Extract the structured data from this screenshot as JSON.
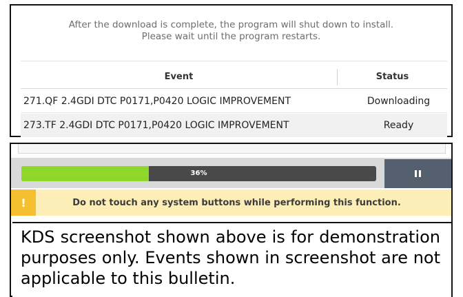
{
  "notice": {
    "line1": "After the download is complete, the program will shut down to install.",
    "line2": "Please wait until the program restarts."
  },
  "table": {
    "headers": {
      "event": "Event",
      "status": "Status"
    },
    "rows": [
      {
        "event": "271.QF 2.4GDI DTC P0171,P0420 LOGIC IMPROVEMENT",
        "status": "Downloading"
      },
      {
        "event": "273.TF 2.4GDI DTC P0171,P0420 LOGIC IMPROVEMENT",
        "status": "Ready"
      }
    ]
  },
  "progress": {
    "value": 36,
    "label": "36%",
    "fill_color": "#8dd82a",
    "track_color": "#494949",
    "pause_icon": "pause-icon"
  },
  "warning": {
    "icon": "!",
    "text": "Do not touch any system buttons while performing this function."
  },
  "disclaimer": {
    "text": "KDS screenshot shown above is for demonstration purposes only. Events shown in screenshot are not applicable to this bulletin."
  },
  "colors": {
    "warning_bg": "#fdeeb7",
    "warning_icon_bg": "#f5c02f",
    "pause_button_bg": "#55606e"
  }
}
